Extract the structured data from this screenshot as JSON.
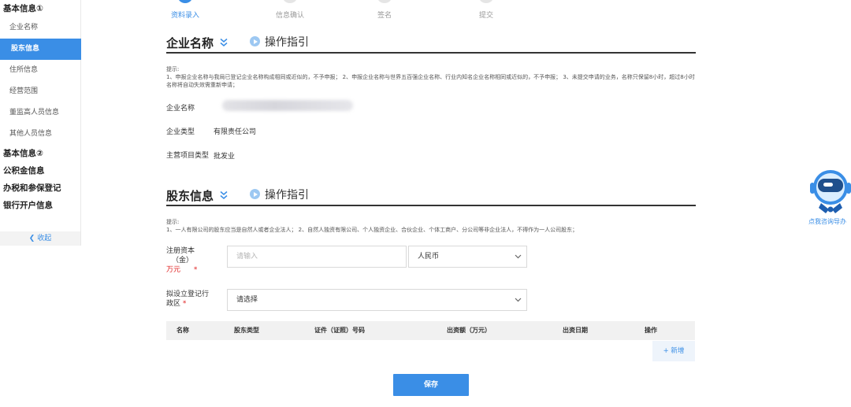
{
  "sidebar": {
    "groups": [
      {
        "label": "基本信息①"
      },
      {
        "label": "基本信息②"
      },
      {
        "label": "公积金信息"
      },
      {
        "label": "办税和参保登记"
      },
      {
        "label": "银行开户信息"
      }
    ],
    "items": [
      {
        "label": "企业名称"
      },
      {
        "label": "股东信息",
        "active": true
      },
      {
        "label": "住所信息"
      },
      {
        "label": "经营范围"
      },
      {
        "label": "董监高人员信息"
      },
      {
        "label": "其他人员信息"
      }
    ],
    "collapse_label": "收起"
  },
  "steps": [
    {
      "label": "资料录入",
      "active": true
    },
    {
      "label": "信息确认"
    },
    {
      "label": "签名"
    },
    {
      "label": "提交"
    }
  ],
  "company_section": {
    "title": "企业名称",
    "guide": "操作指引",
    "tip_title": "提示:",
    "tip_text": "1、申报企业名称与我局已登记企业名称构成相同或近似的，不予申报； 2、申报企业名称与世界五百强企业名称、行业内知名企业名称相同或近似的，不予申报； 3、未提交申请的业务，名称只保留8小时，超过8小时名称将自动失效需重新申请；",
    "fields": [
      {
        "label": "企业名称",
        "value": ""
      },
      {
        "label": "企业类型",
        "value": "有限责任公司"
      },
      {
        "label": "主营项目类型",
        "value": "批发业"
      }
    ]
  },
  "shareholder_section": {
    "title": "股东信息",
    "guide": "操作指引",
    "tip_title": "提示:",
    "tip_text": "1、一人有限公司的股东应当是自然人或者企业法人； 2、自然人独资有限公司、个人独资企业、合伙企业、个体工商户、分公司等非企业法人，不得作为一人公司股东；",
    "capital_label_1": "注册资本",
    "capital_label_2": "（金）",
    "capital_unit": "万元",
    "required_mark": "*",
    "capital_placeholder": "请输入",
    "currency_value": "人民币",
    "region_label_1": "拟设立登记行",
    "region_label_2": "政区",
    "region_value": "请选择",
    "table_headers": [
      "名称",
      "股东类型",
      "证件（证照）号码",
      "出资额（万元）",
      "出资日期",
      "操作"
    ],
    "add_label": "+ 新增"
  },
  "save_label": "保存",
  "assistant_label": "点我咨询导办",
  "colors": {
    "primary": "#3a8ee6",
    "required": "#e02020",
    "header_underline": "#333333"
  }
}
